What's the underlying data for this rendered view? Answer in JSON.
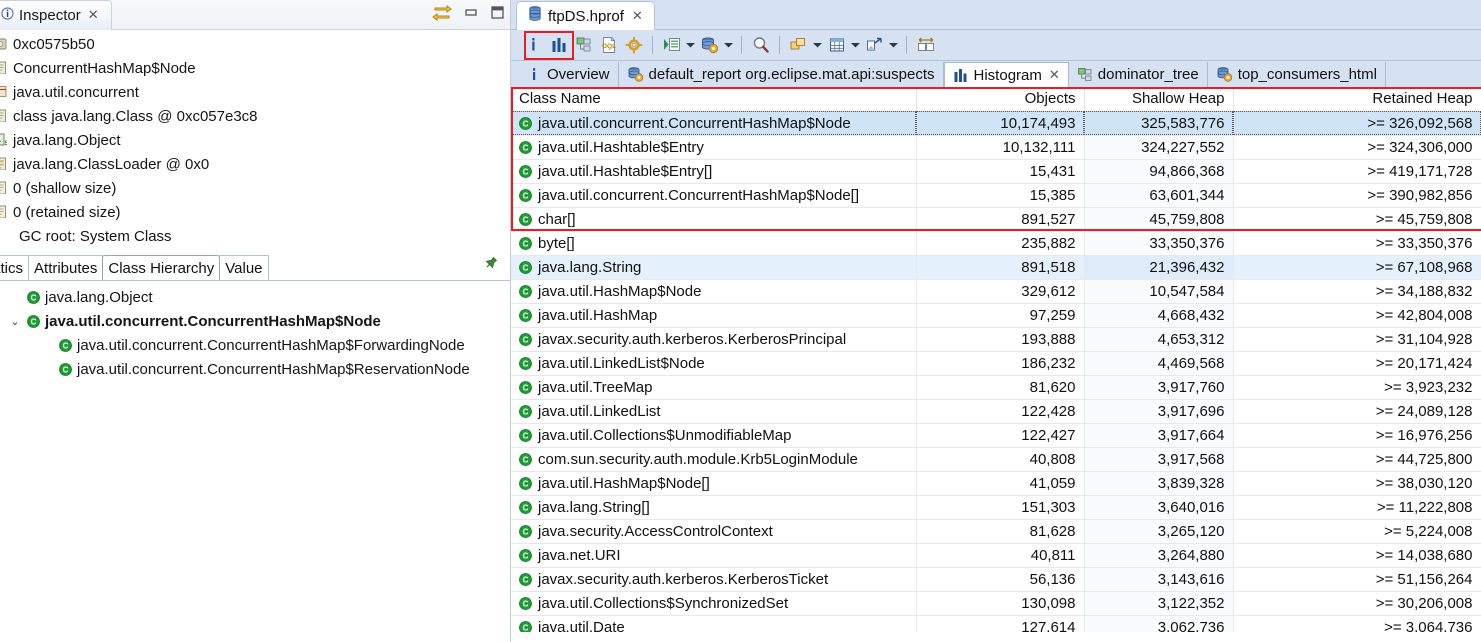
{
  "inspector": {
    "tab_title": "Inspector",
    "close_label": "✕",
    "toolbar_icons": [
      "link-with-editor-icon",
      "minimize-icon",
      "maximize-icon"
    ],
    "fields": [
      {
        "icon": "object-instance-icon",
        "text": "0xc0575b50"
      },
      {
        "icon": "class-icon",
        "text": "ConcurrentHashMap$Node"
      },
      {
        "icon": "package-icon",
        "text": "java.util.concurrent"
      },
      {
        "icon": "class-icon",
        "text": "class java.lang.Class @ 0xc057e3c8"
      },
      {
        "icon": "superclass-icon",
        "text": "java.lang.Object"
      },
      {
        "icon": "classloader-icon",
        "text": "java.lang.ClassLoader @ 0x0"
      },
      {
        "icon": "size-icon",
        "text": "0 (shallow size)"
      },
      {
        "icon": "size-icon",
        "text": "0 (retained size)"
      },
      {
        "icon": "none",
        "text": "GC root: System Class"
      }
    ],
    "bottom_tabs": [
      {
        "label": "tatics",
        "active": false
      },
      {
        "label": "Attributes",
        "active": false
      },
      {
        "label": "Class Hierarchy",
        "active": true
      },
      {
        "label": "Value",
        "active": false
      }
    ],
    "pin_icon": "pin-icon",
    "hierarchy": [
      {
        "label": "java.lang.Object",
        "indent": 0,
        "bold": false,
        "twisty": ""
      },
      {
        "label": "java.util.concurrent.ConcurrentHashMap$Node",
        "indent": 0,
        "bold": true,
        "twisty": "⌄"
      },
      {
        "label": "java.util.concurrent.ConcurrentHashMap$ForwardingNode",
        "indent": 1,
        "bold": false,
        "twisty": ""
      },
      {
        "label": "java.util.concurrent.ConcurrentHashMap$ReservationNode",
        "indent": 1,
        "bold": false,
        "twisty": ""
      }
    ]
  },
  "editor": {
    "tab": {
      "title": "ftpDS.hprof",
      "icon": "heap-dump-icon",
      "close_label": "✕"
    },
    "toolbar": [
      {
        "name": "inspector-icon",
        "type": "icon",
        "highlighted": false
      },
      {
        "name": "histogram-icon",
        "type": "icon",
        "highlighted": true
      },
      {
        "name": "dominator-tree-icon",
        "type": "icon",
        "highlighted": false
      },
      {
        "name": "oql-icon",
        "type": "icon",
        "highlighted": false
      },
      {
        "name": "run-expert-system-icon",
        "type": "icon",
        "highlighted": false
      },
      {
        "name": "separator",
        "type": "sep"
      },
      {
        "name": "queries-icon",
        "type": "icon",
        "highlighted": false
      },
      {
        "name": "queries-dropdown-arrow",
        "type": "arrow"
      },
      {
        "name": "reports-icon",
        "type": "icon",
        "highlighted": false
      },
      {
        "name": "reports-dropdown-arrow",
        "type": "arrow"
      },
      {
        "name": "separator",
        "type": "sep"
      },
      {
        "name": "search-icon",
        "type": "icon",
        "highlighted": false
      },
      {
        "name": "separator",
        "type": "sep"
      },
      {
        "name": "group-by-icon",
        "type": "icon",
        "highlighted": false
      },
      {
        "name": "group-by-dropdown-arrow",
        "type": "arrow"
      },
      {
        "name": "calculate-retained-size-icon",
        "type": "icon",
        "highlighted": false
      },
      {
        "name": "calculate-dropdown-arrow",
        "type": "arrow"
      },
      {
        "name": "export-icon",
        "type": "icon",
        "highlighted": false
      },
      {
        "name": "export-dropdown-arrow",
        "type": "arrow"
      },
      {
        "name": "separator",
        "type": "sep"
      },
      {
        "name": "compare-snapshot-icon",
        "type": "icon",
        "highlighted": false
      }
    ],
    "view_tabs": [
      {
        "label": "Overview",
        "icon": "info-icon",
        "active": false,
        "closeable": false
      },
      {
        "label": "default_report  org.eclipse.mat.api:suspects",
        "icon": "report-icon",
        "active": false,
        "closeable": false
      },
      {
        "label": "Histogram",
        "icon": "histogram-icon",
        "active": true,
        "closeable": true
      },
      {
        "label": "dominator_tree",
        "icon": "dominator-tree-icon",
        "active": false,
        "closeable": false
      },
      {
        "label": "top_consumers_html",
        "icon": "report-icon",
        "active": false,
        "closeable": false
      }
    ]
  },
  "highlight_color": "#ec1c24",
  "chart_data": {
    "type": "table",
    "title": "Histogram",
    "columns": [
      "Class Name",
      "Objects",
      "Shallow Heap",
      "Retained Heap"
    ],
    "sorted_by": "Shallow Heap",
    "sort_direction": "descending",
    "rows": [
      {
        "name": "java.util.concurrent.ConcurrentHashMap$Node",
        "objects": "10,174,493",
        "shallow": "325,583,776",
        "retained": ">= 326,092,568",
        "state": "selected"
      },
      {
        "name": "java.util.Hashtable$Entry",
        "objects": "10,132,111",
        "shallow": "324,227,552",
        "retained": ">= 324,306,000",
        "state": "normal"
      },
      {
        "name": "java.util.Hashtable$Entry[]",
        "objects": "15,431",
        "shallow": "94,866,368",
        "retained": ">= 419,171,728",
        "state": "normal"
      },
      {
        "name": "java.util.concurrent.ConcurrentHashMap$Node[]",
        "objects": "15,385",
        "shallow": "63,601,344",
        "retained": ">= 390,982,856",
        "state": "normal"
      },
      {
        "name": "char[]",
        "objects": "891,527",
        "shallow": "45,759,808",
        "retained": ">= 45,759,808",
        "state": "normal"
      },
      {
        "name": "byte[]",
        "objects": "235,882",
        "shallow": "33,350,376",
        "retained": ">= 33,350,376",
        "state": "normal"
      },
      {
        "name": "java.lang.String",
        "objects": "891,518",
        "shallow": "21,396,432",
        "retained": ">= 67,108,968",
        "state": "highlighted"
      },
      {
        "name": "java.util.HashMap$Node",
        "objects": "329,612",
        "shallow": "10,547,584",
        "retained": ">= 34,188,832",
        "state": "normal"
      },
      {
        "name": "java.util.HashMap",
        "objects": "97,259",
        "shallow": "4,668,432",
        "retained": ">= 42,804,008",
        "state": "normal"
      },
      {
        "name": "javax.security.auth.kerberos.KerberosPrincipal",
        "objects": "193,888",
        "shallow": "4,653,312",
        "retained": ">= 31,104,928",
        "state": "normal"
      },
      {
        "name": "java.util.LinkedList$Node",
        "objects": "186,232",
        "shallow": "4,469,568",
        "retained": ">= 20,171,424",
        "state": "normal"
      },
      {
        "name": "java.util.TreeMap",
        "objects": "81,620",
        "shallow": "3,917,760",
        "retained": ">= 3,923,232",
        "state": "normal"
      },
      {
        "name": "java.util.LinkedList",
        "objects": "122,428",
        "shallow": "3,917,696",
        "retained": ">= 24,089,128",
        "state": "normal"
      },
      {
        "name": "java.util.Collections$UnmodifiableMap",
        "objects": "122,427",
        "shallow": "3,917,664",
        "retained": ">= 16,976,256",
        "state": "normal"
      },
      {
        "name": "com.sun.security.auth.module.Krb5LoginModule",
        "objects": "40,808",
        "shallow": "3,917,568",
        "retained": ">= 44,725,800",
        "state": "normal"
      },
      {
        "name": "java.util.HashMap$Node[]",
        "objects": "41,059",
        "shallow": "3,839,328",
        "retained": ">= 38,030,120",
        "state": "normal"
      },
      {
        "name": "java.lang.String[]",
        "objects": "151,303",
        "shallow": "3,640,016",
        "retained": ">= 11,222,808",
        "state": "normal"
      },
      {
        "name": "java.security.AccessControlContext",
        "objects": "81,628",
        "shallow": "3,265,120",
        "retained": ">= 5,224,008",
        "state": "normal"
      },
      {
        "name": "java.net.URI",
        "objects": "40,811",
        "shallow": "3,264,880",
        "retained": ">= 14,038,680",
        "state": "normal"
      },
      {
        "name": "javax.security.auth.kerberos.KerberosTicket",
        "objects": "56,136",
        "shallow": "3,143,616",
        "retained": ">= 51,156,264",
        "state": "normal"
      },
      {
        "name": "java.util.Collections$SynchronizedSet",
        "objects": "130,098",
        "shallow": "3,122,352",
        "retained": ">= 30,206,008",
        "state": "normal"
      },
      {
        "name": "java.util.Date",
        "objects": "127,614",
        "shallow": "3,062,736",
        "retained": ">= 3,064,736",
        "state": "normal"
      }
    ]
  }
}
